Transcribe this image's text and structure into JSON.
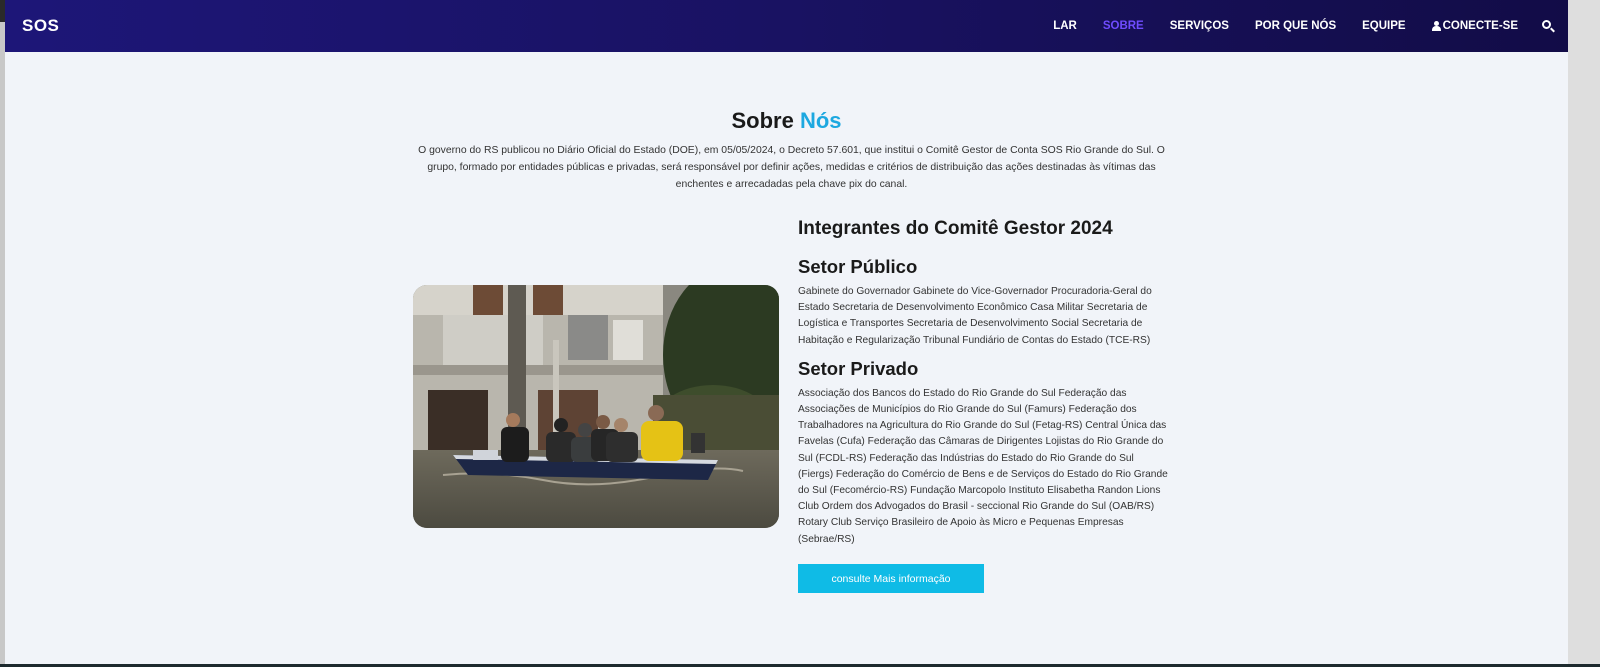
{
  "nav": {
    "brand": "SOS",
    "items": [
      {
        "label": "LAR",
        "active": false
      },
      {
        "label": "SOBRE",
        "active": true
      },
      {
        "label": "SERVIÇOS",
        "active": false
      },
      {
        "label": "POR QUE NÓS",
        "active": false
      },
      {
        "label": "EQUIPE",
        "active": false
      }
    ],
    "connect_label": "CONECTE-SE",
    "active_color": "#6f4cff"
  },
  "about": {
    "title_main": "Sobre ",
    "title_accent": "Nós",
    "accent_color": "#1da8e0",
    "intro": "O governo do RS publicou no Diário Oficial do Estado (DOE), em 05/05/2024, o Decreto 57.601, que institui o Comitê Gestor de Conta SOS Rio Grande do Sul. O grupo, formado por entidades públicas e privadas, será responsável por definir ações, medidas e critérios de distribuição das ações destinadas às vítimas das enchentes e arrecadadas pela chave pix do canal."
  },
  "committee": {
    "heading": "Integrantes do Comitê Gestor 2024",
    "public_heading": "Setor Público",
    "public_text": "Gabinete do Governador Gabinete do Vice-Governador Procuradoria-Geral do Estado Secretaria de Desenvolvimento Econômico Casa Militar Secretaria de Logística e Transportes Secretaria de Desenvolvimento Social Secretaria de Habitação e Regularização Tribunal Fundiário de Contas do Estado (TCE-RS)",
    "private_heading": "Setor Privado",
    "private_text": "Associação dos Bancos do Estado do Rio Grande do Sul Federação das Associações de Municípios do Rio Grande do Sul (Famurs) Federação dos Trabalhadores na Agricultura do Rio Grande do Sul (Fetag-RS) Central Única das Favelas (Cufa) Federação das Câmaras de Dirigentes Lojistas do Rio Grande do Sul (FCDL-RS) Federação das Indústrias do Estado do Rio Grande do Sul (Fiergs) Federação do Comércio de Bens e de Serviços do Estado do Rio Grande do Sul (Fecomércio-RS) Fundação Marcopolo Instituto Elisabetha Randon Lions Club Ordem dos Advogados do Brasil - seccional Rio Grande do Sul (OAB/RS) Rotary Club Serviço Brasileiro de Apoio às Micro e Pequenas Empresas (Sebrae/RS)",
    "cta_label": "consulte Mais informação",
    "cta_color": "#0fbbe6"
  },
  "image": {
    "icon": "flood-rescue-boat-photo"
  }
}
